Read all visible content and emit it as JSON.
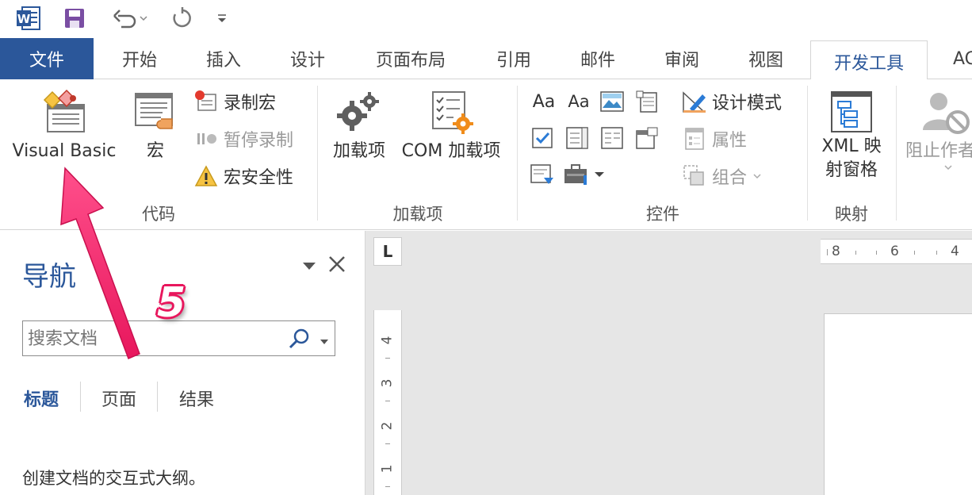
{
  "app": {
    "logo_letter": "W"
  },
  "colors": {
    "accent": "#2b579a",
    "annotation": "#e8175d"
  },
  "tabs": [
    {
      "label": "文件"
    },
    {
      "label": "开始"
    },
    {
      "label": "插入"
    },
    {
      "label": "设计"
    },
    {
      "label": "页面布局"
    },
    {
      "label": "引用"
    },
    {
      "label": "邮件"
    },
    {
      "label": "审阅"
    },
    {
      "label": "视图"
    },
    {
      "label": "开发工具"
    },
    {
      "label": "AC"
    }
  ],
  "ribbon": {
    "code": {
      "label": "代码",
      "visual_basic": "Visual Basic",
      "macros": "宏",
      "record_macro": "录制宏",
      "pause_recording": "暂停录制",
      "macro_security": "宏安全性"
    },
    "addins": {
      "label": "加载项",
      "addins_btn": "加载项",
      "com_addins": "COM 加载项"
    },
    "controls": {
      "label": "控件",
      "rich_text": "Aa",
      "plain_text": "Aa",
      "design_mode": "设计模式",
      "properties": "属性",
      "group": "组合"
    },
    "mapping": {
      "label": "映射",
      "xml_line1": "XML 映",
      "xml_line2": "射窗格"
    },
    "protect": {
      "block_authors": "阻止作者"
    }
  },
  "navigation": {
    "title": "导航",
    "search_placeholder": "搜索文档",
    "tabs": [
      "标题",
      "页面",
      "结果"
    ],
    "hint": "创建文档的交互式大纲。"
  },
  "document": {
    "tab_selector": "L",
    "h_ruler_numbers": [
      "8",
      "6",
      "4"
    ],
    "v_ruler_numbers": [
      "4",
      "3",
      "2",
      "1"
    ]
  },
  "annotation": {
    "step": "5"
  }
}
